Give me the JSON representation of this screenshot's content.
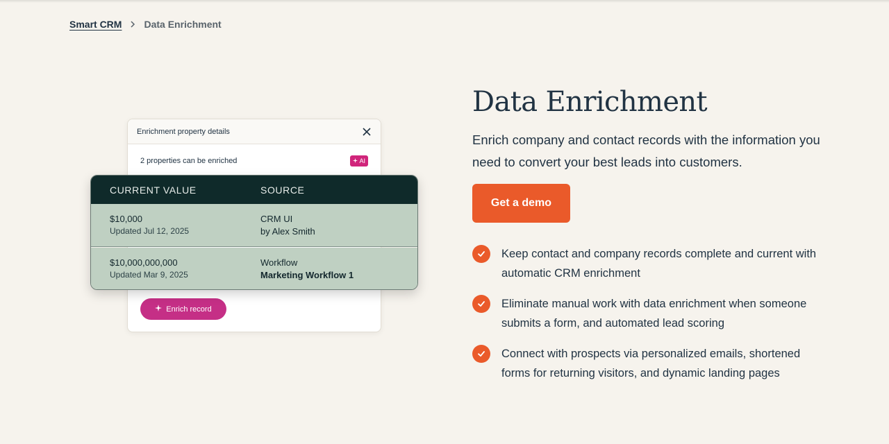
{
  "breadcrumb": {
    "parent": "Smart CRM",
    "current": "Data Enrichment"
  },
  "illustration": {
    "card_title": "Enrichment property details",
    "properties_text": "2 properties can be enriched",
    "ai_badge": "AI",
    "enrich_button": "Enrich record",
    "table": {
      "headers": [
        "CURRENT VALUE",
        "SOURCE"
      ],
      "rows": [
        {
          "value": "$10,000",
          "updated": "Updated Jul 12, 2025",
          "source": "CRM UI",
          "source_detail": "by Alex Smith"
        },
        {
          "value": "$10,000,000,000",
          "updated": "Updated Mar 9, 2025",
          "source": "Workflow",
          "source_detail": "Marketing Workflow 1"
        }
      ]
    }
  },
  "content": {
    "title": "Data Enrichment",
    "description": "Enrich company and contact records with the information you need to convert your best leads into customers.",
    "cta_label": "Get a demo",
    "features": [
      "Keep contact and company records complete and current with automatic CRM enrichment",
      "Eliminate manual work with data enrichment when someone submits a form, and automated lead scoring",
      "Connect with prospects via personalized emails, shortened forms for returning visitors, and dynamic landing pages"
    ]
  },
  "colors": {
    "background": "#f6f3ed",
    "accent": "#ea5a2a",
    "ai_pink": "#d0257b",
    "table_header": "#0f2a2a",
    "table_row": "#bfd0c2"
  },
  "icons": {
    "breadcrumb_separator": "chevron-right-icon",
    "card_close": "close-icon",
    "ai_sparkle": "sparkle-icon",
    "feature_bullet": "check-circle-icon"
  }
}
